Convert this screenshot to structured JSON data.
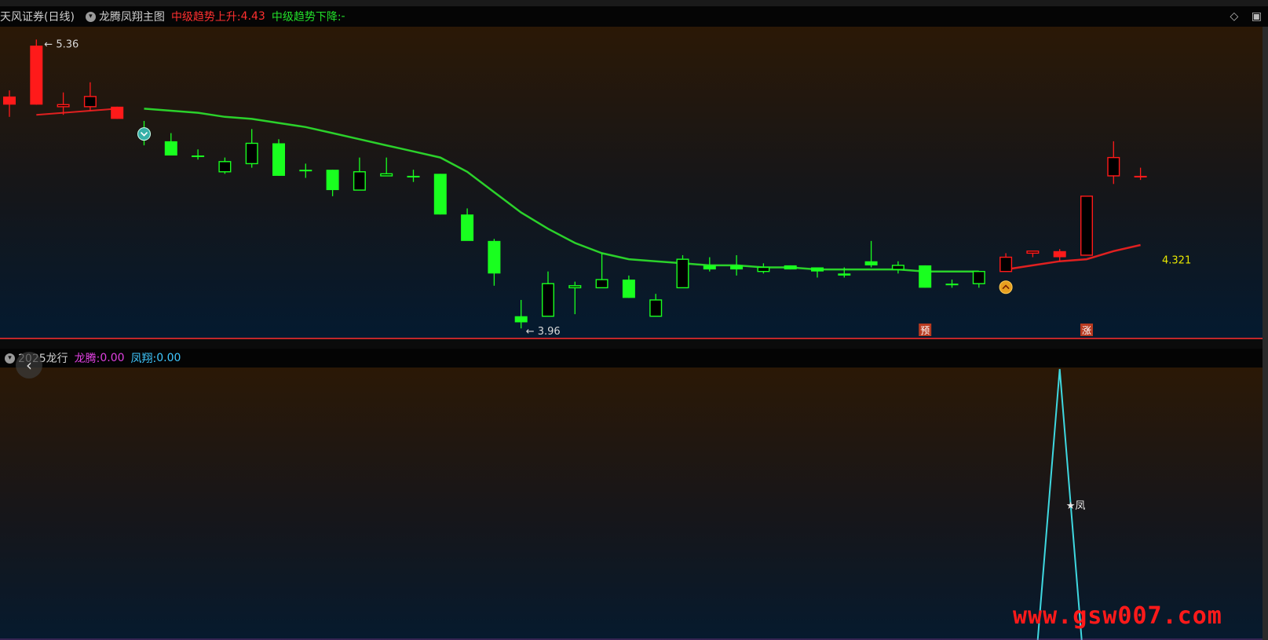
{
  "header": {
    "stock": "天风证券(日线)",
    "indicator": "龙腾凤翔主图",
    "trend_up_label": "中级趋势上升:",
    "trend_up_value": "4.43",
    "trend_down_label": "中级趋势下降:",
    "trend_down_value": "-",
    "diamond_icon": "◇",
    "window_icon": "▣"
  },
  "main": {
    "high_label": "5.36",
    "low_label": "3.96",
    "value_label": "4.321",
    "badge_yu": "预",
    "badge_zhang": "涨"
  },
  "sub": {
    "indicator": "2025龙行",
    "longteng_label": "龙腾:",
    "longteng_value": "0.00",
    "fengxiang_label": "凤翔:",
    "fengxiang_value": "0.00",
    "star_label": "★凤"
  },
  "back_icon": "‹",
  "watermark": "www.gsw007.com",
  "colors": {
    "up": "#ff1a1a",
    "down": "#19ff1f",
    "line_green": "#2bd12b",
    "line_red": "#e02020",
    "cyan": "#3fd8e0",
    "accent_yellow": "#e8e800"
  },
  "chart_data": [
    {
      "type": "candlestick",
      "title": "天风证券(日线)",
      "annotations": [
        "5.36",
        "3.96",
        "4.321"
      ],
      "candles": [
        {
          "o": 5.06,
          "h": 5.13,
          "l": 5.0,
          "c": 5.1,
          "color": "red",
          "fill": "solid"
        },
        {
          "o": 5.06,
          "h": 5.38,
          "l": 5.06,
          "c": 5.35,
          "color": "red",
          "fill": "solid"
        },
        {
          "o": 5.05,
          "h": 5.12,
          "l": 5.01,
          "c": 5.06,
          "color": "red",
          "fill": "hollow"
        },
        {
          "o": 5.1,
          "h": 5.17,
          "l": 5.03,
          "c": 5.05,
          "color": "red",
          "fill": "hollow"
        },
        {
          "o": 4.99,
          "h": 5.05,
          "l": 4.99,
          "c": 5.05,
          "color": "red",
          "fill": "solid"
        },
        {
          "o": 4.93,
          "h": 4.98,
          "l": 4.86,
          "c": 4.91,
          "color": "green",
          "fill": "solid"
        },
        {
          "o": 4.88,
          "h": 4.92,
          "l": 4.82,
          "c": 4.81,
          "color": "green",
          "fill": "solid"
        },
        {
          "o": 4.81,
          "h": 4.84,
          "l": 4.79,
          "c": 4.81,
          "color": "green",
          "fill": "solid"
        },
        {
          "o": 4.73,
          "h": 4.8,
          "l": 4.72,
          "c": 4.78,
          "color": "green",
          "fill": "hollow"
        },
        {
          "o": 4.77,
          "h": 4.94,
          "l": 4.75,
          "c": 4.87,
          "color": "green",
          "fill": "hollow"
        },
        {
          "o": 4.87,
          "h": 4.89,
          "l": 4.71,
          "c": 4.71,
          "color": "green",
          "fill": "solid"
        },
        {
          "o": 4.74,
          "h": 4.77,
          "l": 4.7,
          "c": 4.74,
          "color": "green",
          "fill": "solid"
        },
        {
          "o": 4.74,
          "h": 4.74,
          "l": 4.61,
          "c": 4.64,
          "color": "green",
          "fill": "solid"
        },
        {
          "o": 4.64,
          "h": 4.8,
          "l": 4.64,
          "c": 4.73,
          "color": "green",
          "fill": "hollow"
        },
        {
          "o": 4.71,
          "h": 4.8,
          "l": 4.71,
          "c": 4.72,
          "color": "green",
          "fill": "hollow"
        },
        {
          "o": 4.71,
          "h": 4.74,
          "l": 4.68,
          "c": 4.71,
          "color": "green",
          "fill": "solid"
        },
        {
          "o": 4.72,
          "h": 4.72,
          "l": 4.52,
          "c": 4.52,
          "color": "green",
          "fill": "solid"
        },
        {
          "o": 4.52,
          "h": 4.55,
          "l": 4.44,
          "c": 4.39,
          "color": "green",
          "fill": "solid"
        },
        {
          "o": 4.39,
          "h": 4.4,
          "l": 4.17,
          "c": 4.23,
          "color": "green",
          "fill": "solid"
        },
        {
          "o": 4.02,
          "h": 4.1,
          "l": 3.96,
          "c": 3.99,
          "color": "green",
          "fill": "solid"
        },
        {
          "o": 4.02,
          "h": 4.24,
          "l": 4.02,
          "c": 4.18,
          "color": "green",
          "fill": "hollow"
        },
        {
          "o": 4.16,
          "h": 4.19,
          "l": 4.03,
          "c": 4.17,
          "color": "green",
          "fill": "hollow"
        },
        {
          "o": 4.16,
          "h": 4.33,
          "l": 4.16,
          "c": 4.2,
          "color": "green",
          "fill": "hollow"
        },
        {
          "o": 4.2,
          "h": 4.22,
          "l": 4.11,
          "c": 4.11,
          "color": "green",
          "fill": "solid"
        },
        {
          "o": 4.02,
          "h": 4.13,
          "l": 4.02,
          "c": 4.1,
          "color": "green",
          "fill": "hollow"
        },
        {
          "o": 4.16,
          "h": 4.32,
          "l": 4.16,
          "c": 4.3,
          "color": "green",
          "fill": "hollow"
        },
        {
          "o": 4.27,
          "h": 4.31,
          "l": 4.24,
          "c": 4.25,
          "color": "green",
          "fill": "solid"
        },
        {
          "o": 4.27,
          "h": 4.32,
          "l": 4.22,
          "c": 4.25,
          "color": "green",
          "fill": "solid"
        },
        {
          "o": 4.24,
          "h": 4.28,
          "l": 4.23,
          "c": 4.26,
          "color": "green",
          "fill": "hollow"
        },
        {
          "o": 4.25,
          "h": 4.27,
          "l": 4.25,
          "c": 4.27,
          "color": "green",
          "fill": "solid"
        },
        {
          "o": 4.26,
          "h": 4.26,
          "l": 4.21,
          "c": 4.24,
          "color": "green",
          "fill": "solid"
        },
        {
          "o": 4.23,
          "h": 4.26,
          "l": 4.21,
          "c": 4.22,
          "color": "green",
          "fill": "solid"
        },
        {
          "o": 4.27,
          "h": 4.39,
          "l": 4.26,
          "c": 4.29,
          "color": "green",
          "fill": "solid"
        },
        {
          "o": 4.25,
          "h": 4.29,
          "l": 4.23,
          "c": 4.27,
          "color": "green",
          "fill": "hollow"
        },
        {
          "o": 4.27,
          "h": 4.27,
          "l": 4.16,
          "c": 4.16,
          "color": "green",
          "fill": "solid"
        },
        {
          "o": 4.18,
          "h": 4.2,
          "l": 4.16,
          "c": 4.18,
          "color": "green",
          "fill": "solid"
        },
        {
          "o": 4.18,
          "h": 4.24,
          "l": 4.16,
          "c": 4.24,
          "color": "green",
          "fill": "hollow"
        },
        {
          "o": 4.24,
          "h": 4.33,
          "l": 4.24,
          "c": 4.31,
          "color": "red",
          "fill": "hollow"
        },
        {
          "o": 4.33,
          "h": 4.34,
          "l": 4.31,
          "c": 4.34,
          "color": "red",
          "fill": "hollow"
        },
        {
          "o": 4.31,
          "h": 4.35,
          "l": 4.29,
          "c": 4.34,
          "color": "red",
          "fill": "solid"
        },
        {
          "o": 4.32,
          "h": 4.61,
          "l": 4.32,
          "c": 4.61,
          "color": "red",
          "fill": "hollow"
        },
        {
          "o": 4.71,
          "h": 4.88,
          "l": 4.67,
          "c": 4.8,
          "color": "red",
          "fill": "hollow"
        },
        {
          "o": 4.71,
          "h": 4.75,
          "l": 4.69,
          "c": 4.71,
          "color": "red",
          "fill": "solid"
        }
      ],
      "ma": [
        null,
        5.01,
        5.02,
        5.03,
        5.04,
        5.04,
        5.03,
        5.02,
        5.0,
        4.99,
        4.97,
        4.95,
        4.92,
        4.89,
        4.86,
        4.83,
        4.8,
        4.73,
        4.63,
        4.53,
        4.45,
        4.38,
        4.33,
        4.3,
        4.29,
        4.28,
        4.27,
        4.27,
        4.26,
        4.26,
        4.25,
        4.25,
        4.25,
        4.25,
        4.24,
        4.24,
        4.24,
        4.25,
        4.27,
        4.29,
        4.3,
        4.34,
        4.37
      ],
      "ylim": [
        3.93,
        5.42
      ]
    },
    {
      "type": "line",
      "title": "2025龙行",
      "series": [
        {
          "name": "龙腾",
          "values": [
            0,
            0,
            0,
            0,
            0,
            0,
            0,
            0,
            0,
            0,
            0,
            0,
            0,
            0,
            0,
            0,
            0,
            0,
            0,
            0,
            0,
            0,
            0,
            0,
            0,
            0,
            0,
            0,
            0,
            0,
            0,
            0,
            0,
            0,
            0,
            0,
            0,
            0,
            0,
            0,
            0,
            0,
            0
          ]
        },
        {
          "name": "凤翔",
          "values": [
            0,
            0,
            0,
            0,
            0,
            0,
            0,
            0,
            0,
            0,
            0,
            0,
            0,
            0,
            0,
            0,
            0,
            0,
            0,
            0,
            0,
            0,
            0,
            0,
            0,
            0,
            0,
            0,
            0,
            0,
            0,
            0,
            0,
            0,
            0,
            0,
            0,
            0,
            0,
            1,
            0,
            0,
            0
          ]
        }
      ],
      "ylim": [
        0,
        1
      ]
    }
  ]
}
